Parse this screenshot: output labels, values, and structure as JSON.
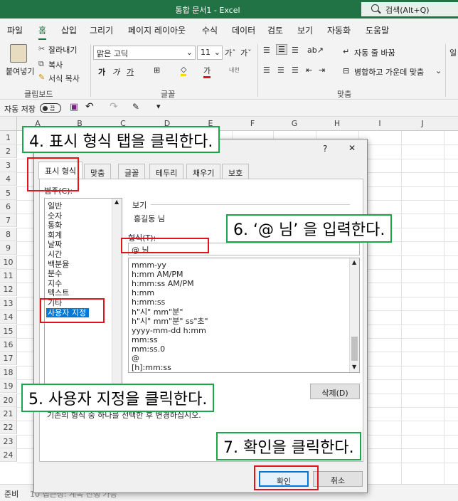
{
  "window": {
    "title": "통합 문서1  -  Excel",
    "search_placeholder": "검색(Alt+Q)"
  },
  "menu_tabs": [
    "파일",
    "홈",
    "삽입",
    "그리기",
    "페이지 레이아웃",
    "수식",
    "데이터",
    "검토",
    "보기",
    "자동화",
    "도움말"
  ],
  "ribbon": {
    "paste": "붙여넣기",
    "cut": "잘라내기",
    "copy": "복사",
    "format_painter": "서식 복사",
    "clipboard_label": "클립보드",
    "font_name": "맑은 고딕",
    "font_size": "11",
    "font_label": "글꼴",
    "wrap_text": "자동 줄 바꿈",
    "merge_center": "병합하고 가운데 맞춤",
    "align_label": "맞춤",
    "cut_right": "일"
  },
  "qat": {
    "autosave": "자동 저장",
    "toggle": "끔"
  },
  "columns": [
    "A",
    "B",
    "C",
    "D",
    "E",
    "F",
    "G",
    "H",
    "I",
    "J"
  ],
  "rows": [
    "1",
    "2",
    "3",
    "4",
    "5",
    "6",
    "7",
    "8",
    "9",
    "10",
    "11",
    "12",
    "13",
    "14",
    "15",
    "16",
    "17",
    "18",
    "19",
    "20",
    "21",
    "22",
    "23",
    "24"
  ],
  "status": {
    "mode": "준비",
    "hidden_text": "10 접근성: 계속 진행 가능"
  },
  "dialog": {
    "help": "?",
    "close": "✕",
    "tabs": [
      "표시 형식",
      "맞춤",
      "글꼴",
      "테두리",
      "채우기",
      "보호"
    ],
    "category_label": "범주(C):",
    "categories": [
      "일반",
      "숫자",
      "통화",
      "회계",
      "날짜",
      "시간",
      "백분율",
      "분수",
      "지수",
      "텍스트",
      "기타",
      "사용자 지정"
    ],
    "sample_label": "보기",
    "sample_value": "홍길동 님",
    "format_label": "형식(T):",
    "format_input": "@ 님",
    "formats": [
      "mmm-yy",
      "h:mm AM/PM",
      "h:mm:ss AM/PM",
      "h:mm",
      "h:mm:ss",
      "h\"시\" mm\"분\"",
      "h\"시\" mm\"분\" ss\"초\"",
      "yyyy-mm-dd h:mm",
      "mm:ss",
      "mm:ss.0",
      "@",
      "[h]:mm:ss"
    ],
    "delete_button": "삭제(D)",
    "description": "기존의 형식 중 하나를 선택한 후 변경하십시오.",
    "ok_button": "확인",
    "cancel_button": "취소"
  },
  "callouts": {
    "step4": "4. 표시 형식 탭을 클릭한다.",
    "step5": "5. 사용자 지정을 클릭한다.",
    "step6": "6. ‘@ 님’ 을 입력한다.",
    "step7": "7. 확인을 클릭한다."
  },
  "colors": {
    "excel_green": "#217346",
    "highlight_red": "#e3131c",
    "callout_green": "#18a84a",
    "selection_blue": "#0078d7"
  }
}
